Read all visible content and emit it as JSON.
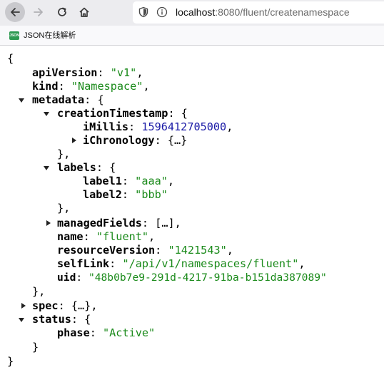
{
  "browser": {
    "url_host": "localhost",
    "url_rest": ":8080/fluent/createnamespace",
    "bookmark_icon_text": "JSON",
    "bookmark_label": "JSON在线解析"
  },
  "json": {
    "open_brace": "{",
    "close_brace": "}",
    "apiVersion_key": "apiVersion",
    "apiVersion_value": "\"v1\"",
    "kind_key": "kind",
    "kind_value": "\"Namespace\"",
    "metadata_key": "metadata",
    "creationTimestamp_key": "creationTimestamp",
    "iMillis_key": "iMillis",
    "iMillis_value": "1596412705000",
    "iChronology_key": "iChronology",
    "collapsed_object": "{…}",
    "collapsed_array": "[…]",
    "labels_key": "labels",
    "label1_key": "label1",
    "label1_value": "\"aaa\"",
    "label2_key": "label2",
    "label2_value": "\"bbb\"",
    "managedFields_key": "managedFields",
    "name_key": "name",
    "name_value": "\"fluent\"",
    "resourceVersion_key": "resourceVersion",
    "resourceVersion_value": "\"1421543\"",
    "selfLink_key": "selfLink",
    "selfLink_value": "\"/api/v1/namespaces/fluent\"",
    "uid_key": "uid",
    "uid_value": "\"48b0b7e9-291d-4217-91ba-b151da387089\"",
    "spec_key": "spec",
    "status_key": "status",
    "phase_key": "phase",
    "phase_value": "\"Active\""
  },
  "colors": {
    "string": "#1a8a1a",
    "number": "#1a1aa6",
    "key": "#000000"
  }
}
